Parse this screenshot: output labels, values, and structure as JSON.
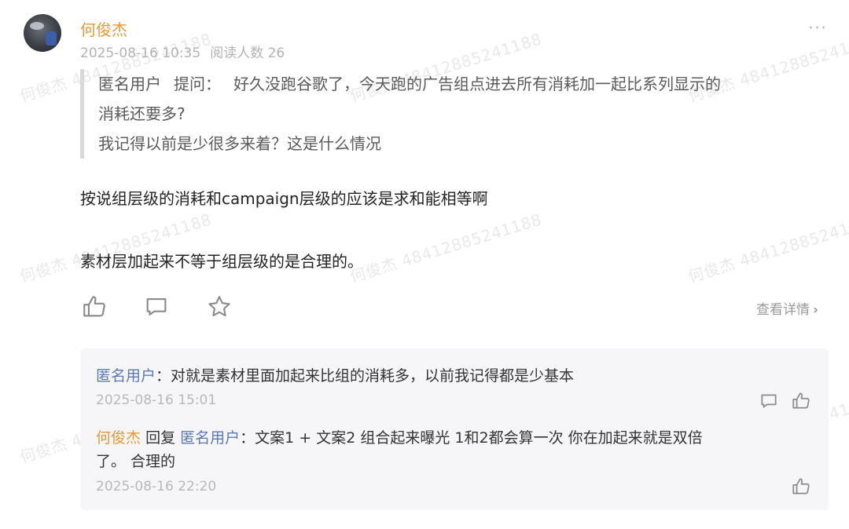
{
  "post": {
    "author": "何俊杰",
    "date": "2025-08-16 10:35",
    "reads": "阅读人数 26",
    "more_label": "···"
  },
  "question": {
    "asker": "匿名用户",
    "label": "提问：",
    "line1": "好久没跑谷歌了，今天跑的广告组点进去所有消耗加一起比系列显示的",
    "line2": "消耗还要多?",
    "line3": "我记得以前是少很多来着？这是什么情况"
  },
  "answer": {
    "paragraph1": "按说组层级的消耗和campaign层级的应该是求和能相等啊",
    "paragraph2": "素材层加起来不等于组层级的是合理的。"
  },
  "actions": {
    "like_icon": "thumbs-up-icon",
    "comment_icon": "comment-icon",
    "favorite_icon": "star-icon",
    "detail_label": "查看详情",
    "detail_arrow": "›"
  },
  "comments": [
    {
      "user": "匿名用户",
      "separator": "：",
      "text": "对就是素材里面加起来比组的消耗多，以前我记得都是少基本",
      "time": "2025-08-16 15:01"
    },
    {
      "user": "何俊杰",
      "reply_word": "回复",
      "reply_to": "匿名用户",
      "separator": "：",
      "text_line1": "文案1 + 文案2 组合起来曝光  1和2都会算一次 你在加起来就是双倍",
      "text_line2": "了。 合理的",
      "time": "2025-08-16 22:20"
    }
  ],
  "watermark": {
    "text": "何俊杰 48412885241188"
  },
  "colors": {
    "author": "#e39a3b",
    "comment_user": "#5a79b6",
    "muted": "#b3b3b3",
    "comment_bg": "#f6f6f8"
  }
}
